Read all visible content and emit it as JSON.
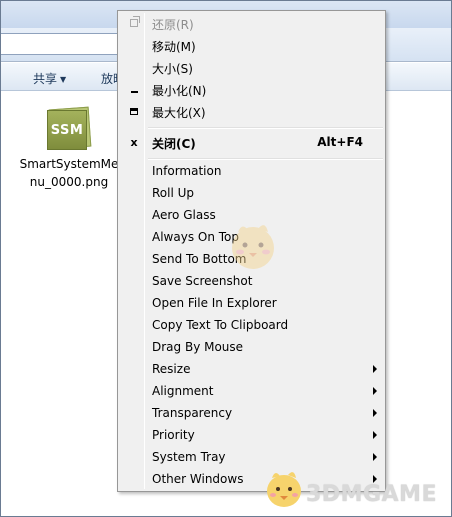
{
  "toolbar": {
    "share_label": "共享",
    "play_label": "放映"
  },
  "file": {
    "icon_text": "SSM",
    "name": "SmartSystemMenu_0000.png"
  },
  "menu": {
    "items": [
      {
        "label": "还原(R)",
        "icon": "restore-icon",
        "disabled": true
      },
      {
        "label": "移动(M)"
      },
      {
        "label": "大小(S)"
      },
      {
        "label": "最小化(N)",
        "icon": "minimize-icon"
      },
      {
        "label": "最大化(X)",
        "icon": "maximize-icon"
      },
      {
        "label": "关闭(C)",
        "icon": "close-icon",
        "shortcut": "Alt+F4",
        "bold": true
      },
      {
        "label": "Information"
      },
      {
        "label": "Roll Up"
      },
      {
        "label": "Aero Glass"
      },
      {
        "label": "Always On Top"
      },
      {
        "label": "Send To Bottom"
      },
      {
        "label": "Save Screenshot"
      },
      {
        "label": "Open File In Explorer"
      },
      {
        "label": "Copy Text To Clipboard"
      },
      {
        "label": "Drag By Mouse"
      },
      {
        "label": "Resize",
        "submenu": true
      },
      {
        "label": "Alignment",
        "submenu": true
      },
      {
        "label": "Transparency",
        "submenu": true
      },
      {
        "label": "Priority",
        "submenu": true
      },
      {
        "label": "System Tray",
        "submenu": true
      },
      {
        "label": "Other Windows",
        "submenu": true
      }
    ],
    "close_icon_glyph": "x"
  },
  "watermark": {
    "text": "3DMGAME"
  }
}
